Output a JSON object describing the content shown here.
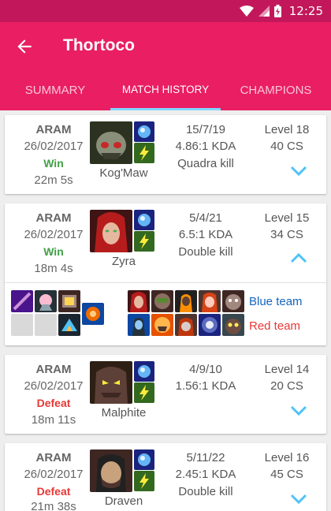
{
  "status": {
    "time": "12:25"
  },
  "header": {
    "title": "Thortoco"
  },
  "tabs": [
    {
      "label": "SUMMARY"
    },
    {
      "label": "MATCH HISTORY"
    },
    {
      "label": "CHAMPIONS"
    }
  ],
  "matches": [
    {
      "mode": "ARAM",
      "date": "26/02/2017",
      "result": "Win",
      "duration": "22m 5s",
      "champion": "Kog'Maw",
      "kda": "15/7/19",
      "ratio": "4.86:1 KDA",
      "multikill": "Quadra kill",
      "level": "Level 18",
      "cs": "40 CS",
      "expanded": false
    },
    {
      "mode": "ARAM",
      "date": "26/02/2017",
      "result": "Win",
      "duration": "18m 4s",
      "champion": "Zyra",
      "kda": "5/4/21",
      "ratio": "6.5:1 KDA",
      "multikill": "Double kill",
      "level": "Level 15",
      "cs": "34 CS",
      "expanded": true
    },
    {
      "mode": "ARAM",
      "date": "26/02/2017",
      "result": "Defeat",
      "duration": "18m 11s",
      "champion": "Malphite",
      "kda": "4/9/10",
      "ratio": "1.56:1 KDA",
      "multikill": "",
      "level": "Level 14",
      "cs": "20 CS",
      "expanded": false
    },
    {
      "mode": "ARAM",
      "date": "26/02/2017",
      "result": "Defeat",
      "duration": "21m 38s",
      "champion": "Draven",
      "kda": "5/11/22",
      "ratio": "2.45:1 KDA",
      "multikill": "Double kill",
      "level": "Level 16",
      "cs": "45 CS",
      "expanded": false
    }
  ],
  "teams": {
    "blue": "Blue team",
    "red": "Red team"
  },
  "colors": {
    "statusbar": "#c2185b",
    "appbar": "#e91e63",
    "accent": "#80d8ff",
    "win": "#43a047",
    "defeat": "#e53935",
    "blue_team": "#1565c0",
    "red_team": "#e53935",
    "chevron": "#4fc3f7"
  }
}
